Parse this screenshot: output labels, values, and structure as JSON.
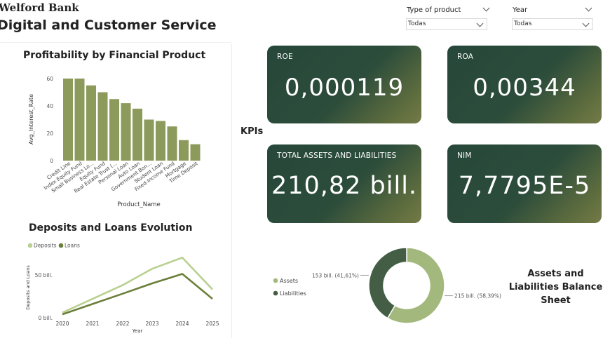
{
  "header": {
    "brand": "Welford Bank",
    "title": "Digital and Customer Service"
  },
  "filters": [
    {
      "label": "Type of product",
      "value": "Todas"
    },
    {
      "label": "Year",
      "value": "Todas"
    }
  ],
  "profitability": {
    "title": "Profitability by Financial Product",
    "chart_data": {
      "type": "bar",
      "title": "Profitability by Financial Product",
      "xlabel": "Product_Name",
      "ylabel": "Avg_Interest_Rate",
      "ylim": [
        0,
        60
      ],
      "yticks": [
        0,
        20,
        40,
        60
      ],
      "categories": [
        "Credit Line",
        "Index Equity Fund",
        "Small Business Lo...",
        "Equity Fund",
        "Real Estate Trust (...",
        "Personal Loan",
        "Auto Loan",
        "Government Bon...",
        "Student Loan",
        "Fixed-Income Fund",
        "Mortgage",
        "Time Deposit"
      ],
      "values": [
        60,
        60,
        55,
        50,
        45,
        42,
        38,
        30,
        29,
        25,
        15,
        12
      ],
      "color": "#8c9a5b"
    }
  },
  "kpis": {
    "section_label": "KPIs",
    "cards": [
      {
        "label": "ROE",
        "value": "0,000119"
      },
      {
        "label": "ROA",
        "value": "0,00344"
      },
      {
        "label": "TOTAL ASSETS AND LIABILITIES",
        "value": "210,82 bill."
      },
      {
        "label": "NIM",
        "value": "7,7795E-5"
      }
    ]
  },
  "deposits_loans": {
    "title": "Deposits and Loans Evolution",
    "chart_data": {
      "type": "line",
      "title": "Deposits and Loans Evolution",
      "xlabel": "Year",
      "ylabel": "Deposits and Loans",
      "x": [
        "2020",
        "2021",
        "2022",
        "2023",
        "2024",
        "2025"
      ],
      "ylim": [
        0,
        80
      ],
      "yticks": [
        {
          "value": 0,
          "label": "0 bill."
        },
        {
          "value": 50,
          "label": "50 bill."
        }
      ],
      "legend": "top-left",
      "series": [
        {
          "name": "Deposits",
          "color": "#b9d090",
          "values": [
            6,
            22,
            38,
            57,
            70,
            33
          ]
        },
        {
          "name": "Loans",
          "color": "#6b7f3a",
          "values": [
            4,
            16,
            28,
            40,
            51,
            22
          ]
        }
      ]
    }
  },
  "balance": {
    "title": "Assets and Liabilities Balance Sheet",
    "chart_data": {
      "type": "pie",
      "title": "Assets and Liabilities Balance Sheet",
      "legend": "left",
      "categories": [
        "Assets",
        "Liabilities"
      ],
      "values": [
        215,
        153
      ],
      "percents": [
        58.39,
        41.61
      ],
      "labels": [
        "215 bill. (58,39%)",
        "153 bill. (41,61%)"
      ],
      "colors": [
        "#a3b87c",
        "#435e44"
      ]
    }
  }
}
